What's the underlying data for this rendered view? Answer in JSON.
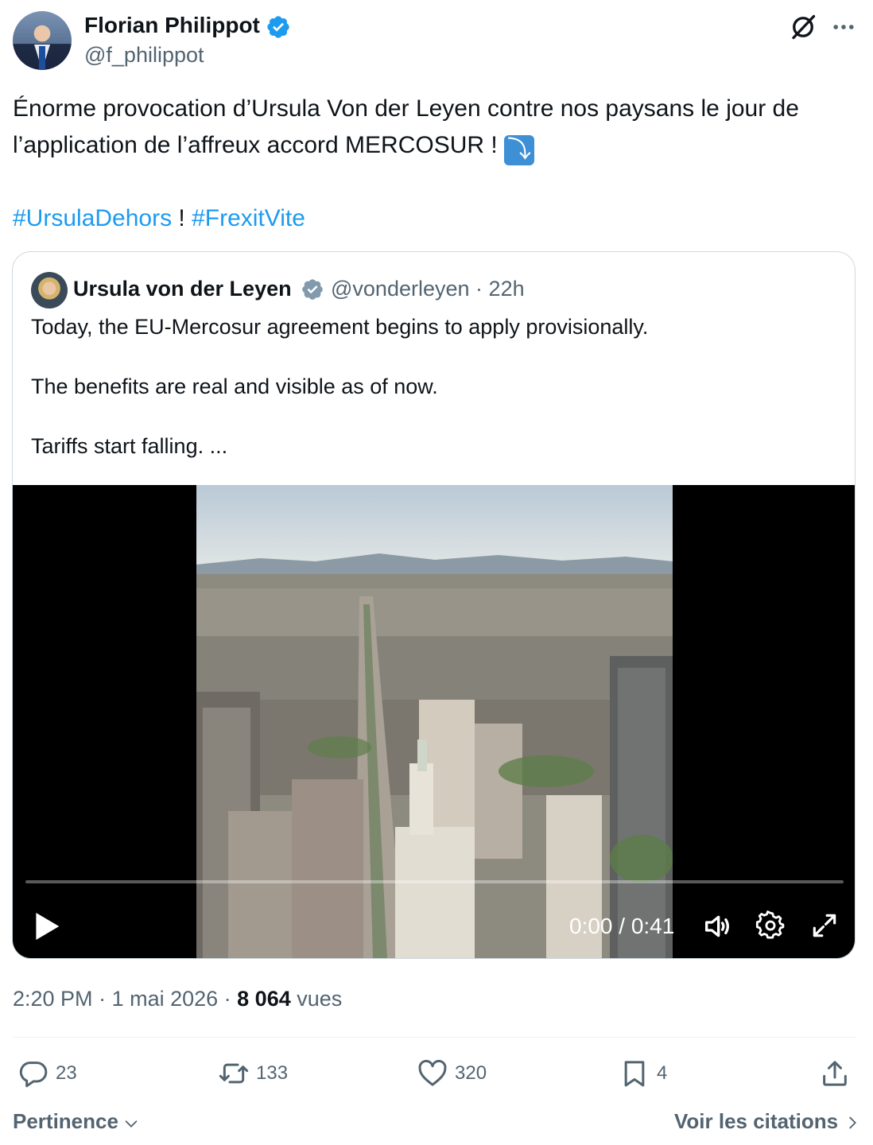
{
  "author": {
    "name": "Florian Philippot",
    "handle": "@f_philippot"
  },
  "tweet": {
    "line1": "Énorme provocation d’Ursula Von der Leyen contre nos paysans le jour de l’application de l’affreux accord MERCOSUR ! ",
    "emoji": "⤵",
    "hashtag1": "#UrsulaDehors",
    "separator": " ! ",
    "hashtag2": "#FrexitVite"
  },
  "quote": {
    "name": "Ursula von der Leyen",
    "handle": "@vonderleyen",
    "dot": "·",
    "time": "22h",
    "paragraphs": [
      "Today, the EU-Mercosur agreement begins to apply provisionally.",
      "The benefits are real and visible as of now.",
      "Tariffs start falling. ..."
    ],
    "video": {
      "time_display": "0:00 / 0:41",
      "progress": 0
    }
  },
  "meta": {
    "time": "2:20 PM",
    "sep1": " · ",
    "date": "1 mai 2026",
    "sep2": " · ",
    "views": "8 064",
    "views_label": " vues"
  },
  "actions": {
    "replies": "23",
    "retweets": "133",
    "likes": "320",
    "bookmarks": "4"
  },
  "footer": {
    "sort_label": "Pertinence",
    "quotes_label": "Voir les citations"
  },
  "colors": {
    "accent": "#1d9bf0",
    "muted": "#536471",
    "text": "#0f1419"
  },
  "icons": [
    "verified-icon",
    "grok-icon",
    "more-icon",
    "play-icon",
    "volume-icon",
    "settings-icon",
    "fullscreen-icon",
    "reply-icon",
    "retweet-icon",
    "like-icon",
    "bookmark-icon",
    "share-icon",
    "chevron-down-icon",
    "chevron-right-icon"
  ]
}
